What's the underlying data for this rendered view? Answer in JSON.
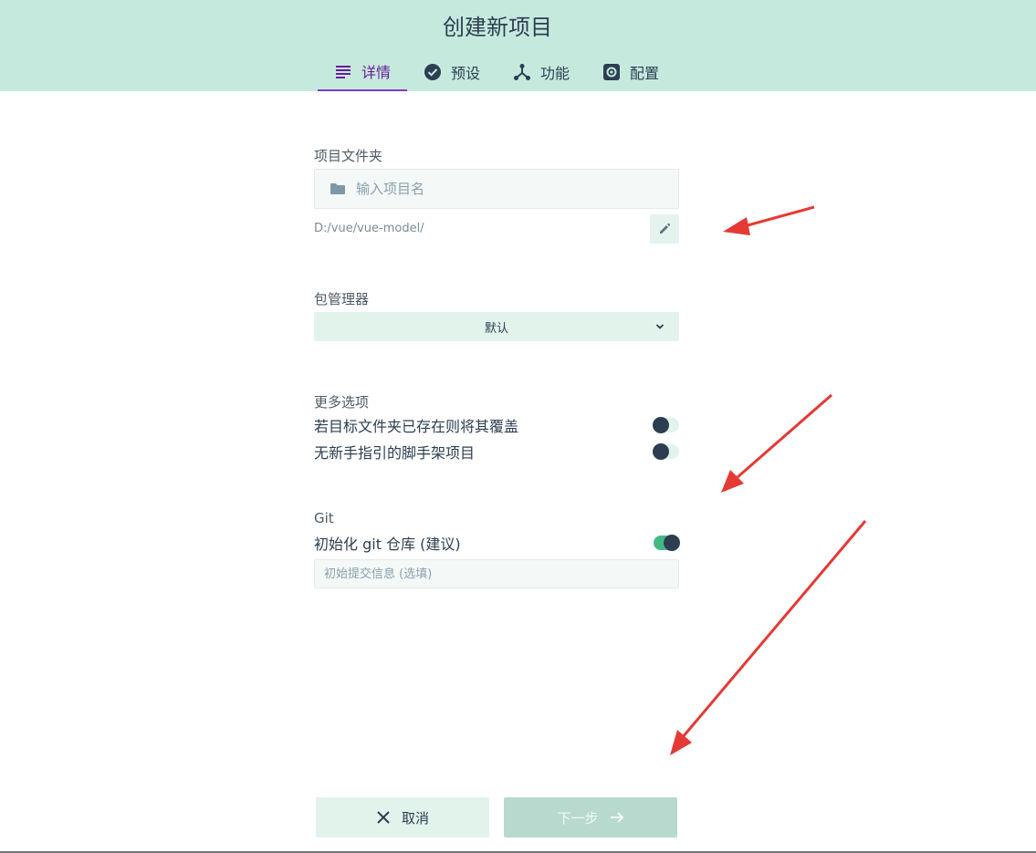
{
  "header": {
    "title": "创建新项目",
    "tabs": [
      {
        "label": "详情",
        "icon": "list-icon",
        "active": true
      },
      {
        "label": "预设",
        "icon": "check-circle-icon",
        "active": false
      },
      {
        "label": "功能",
        "icon": "branch-icon",
        "active": false
      },
      {
        "label": "配置",
        "icon": "gear-icon",
        "active": false
      }
    ]
  },
  "folder": {
    "label": "项目文件夹",
    "placeholder": "输入项目名",
    "path": "D:/vue/vue-model/"
  },
  "package_manager": {
    "label": "包管理器",
    "selected": "默认"
  },
  "more_options": {
    "label": "更多选项",
    "options": [
      {
        "label": "若目标文件夹已存在则将其覆盖",
        "enabled": false
      },
      {
        "label": "无新手指引的脚手架项目",
        "enabled": false
      }
    ]
  },
  "git": {
    "label": "Git",
    "init_label": "初始化 git 仓库 (建议)",
    "init_enabled": true,
    "commit_placeholder": "初始提交信息 (选填)"
  },
  "footer": {
    "cancel_label": "取消",
    "next_label": "下一步"
  },
  "colors": {
    "header_bg": "#c6e9de",
    "accent": "#42b983",
    "active_tab": "#6a1b9a",
    "annotation_arrow": "#e53935"
  }
}
